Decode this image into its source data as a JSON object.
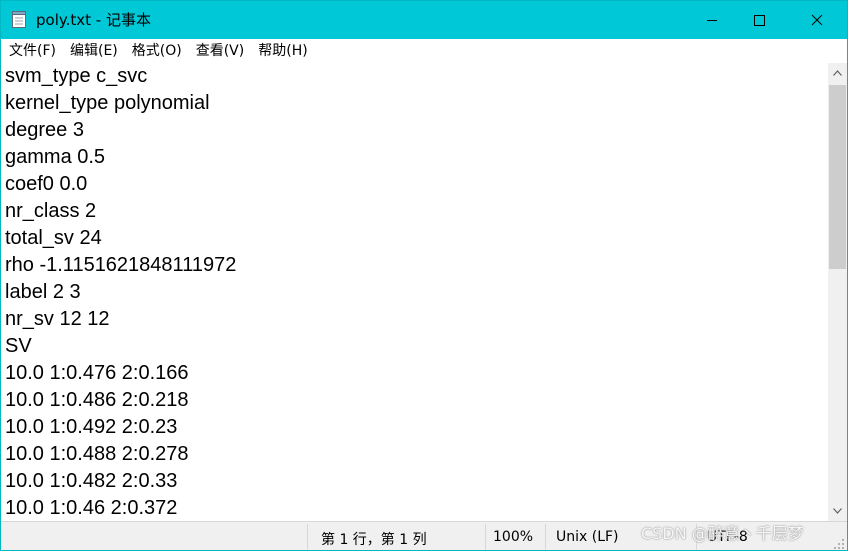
{
  "window": {
    "title": "poly.txt - 记事本"
  },
  "menu": [
    "文件(F)",
    "编辑(E)",
    "格式(O)",
    "查看(V)",
    "帮助(H)"
  ],
  "editor": {
    "lines": [
      "svm_type c_svc",
      "kernel_type polynomial",
      "degree 3",
      "gamma 0.5",
      "coef0 0.0",
      "nr_class 2",
      "total_sv 24",
      "rho -1.1151621848111972",
      "label 2 3",
      "nr_sv 12 12",
      "SV",
      "10.0 1:0.476 2:0.166",
      "10.0 1:0.486 2:0.218",
      "10.0 1:0.492 2:0.23",
      "10.0 1:0.488 2:0.278",
      "10.0 1:0.482 2:0.33",
      "10.0 1:0.46 2:0.372"
    ]
  },
  "status": {
    "position": "第 1 行，第 1 列",
    "zoom": "100%",
    "line_ending": "Unix (LF)",
    "encoding": "UTF-8"
  },
  "watermark": "CSDN @醉意丶千层梦",
  "colors": {
    "titlebar": "#00c8d7",
    "statusbar": "#f0f0f0",
    "scroll_thumb": "#cdcdcd"
  }
}
